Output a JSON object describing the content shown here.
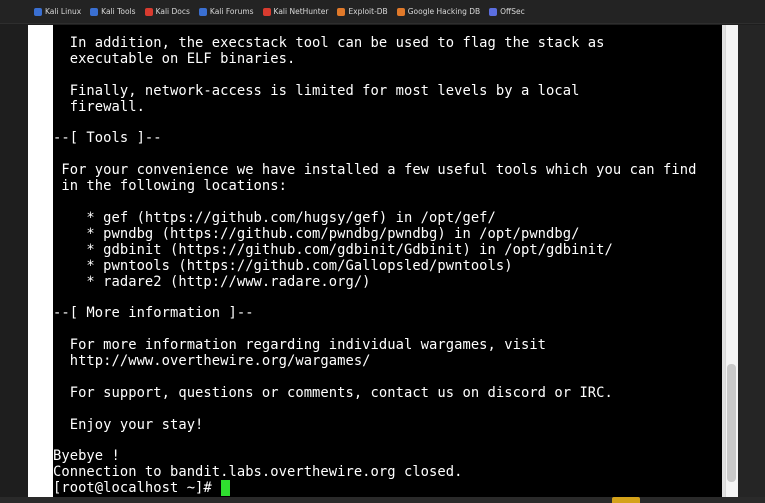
{
  "bookmarks": [
    {
      "label": "Kali Linux",
      "icon": "kali-icon",
      "color": "#3a6fd1"
    },
    {
      "label": "Kali Tools",
      "icon": "kali-tools-icon",
      "color": "#3a6fd1"
    },
    {
      "label": "Kali Docs",
      "icon": "kali-docs-icon",
      "color": "#d83b2f"
    },
    {
      "label": "Kali Forums",
      "icon": "kali-forums-icon",
      "color": "#3a6fd1"
    },
    {
      "label": "Kali NetHunter",
      "icon": "nethunter-icon",
      "color": "#d83b2f"
    },
    {
      "label": "Exploit-DB",
      "icon": "exploit-db-icon",
      "color": "#e0792a"
    },
    {
      "label": "Google Hacking DB",
      "icon": "ghdb-icon",
      "color": "#e0792a"
    },
    {
      "label": "OffSec",
      "icon": "offsec-icon",
      "color": "#5b6ee0"
    }
  ],
  "terminal": {
    "lines": [
      "  In addition, the execstack tool can be used to flag the stack as",
      "  executable on ELF binaries.",
      "",
      "  Finally, network-access is limited for most levels by a local",
      "  firewall.",
      "",
      "--[ Tools ]--",
      "",
      " For your convenience we have installed a few useful tools which you can find",
      " in the following locations:",
      "",
      "    * gef (https://github.com/hugsy/gef) in /opt/gef/",
      "    * pwndbg (https://github.com/pwndbg/pwndbg) in /opt/pwndbg/",
      "    * gdbinit (https://github.com/gdbinit/Gdbinit) in /opt/gdbinit/",
      "    * pwntools (https://github.com/Gallopsled/pwntools)",
      "    * radare2 (http://www.radare.org/)",
      "",
      "--[ More information ]--",
      "",
      "  For more information regarding individual wargames, visit",
      "  http://www.overthewire.org/wargames/",
      "",
      "  For support, questions or comments, contact us on discord or IRC.",
      "",
      "  Enjoy your stay!",
      "",
      "Byebye !",
      "Connection to bandit.labs.overthewire.org closed.",
      "[root@localhost ~]# "
    ],
    "cursor_color": "#2fe02f"
  }
}
